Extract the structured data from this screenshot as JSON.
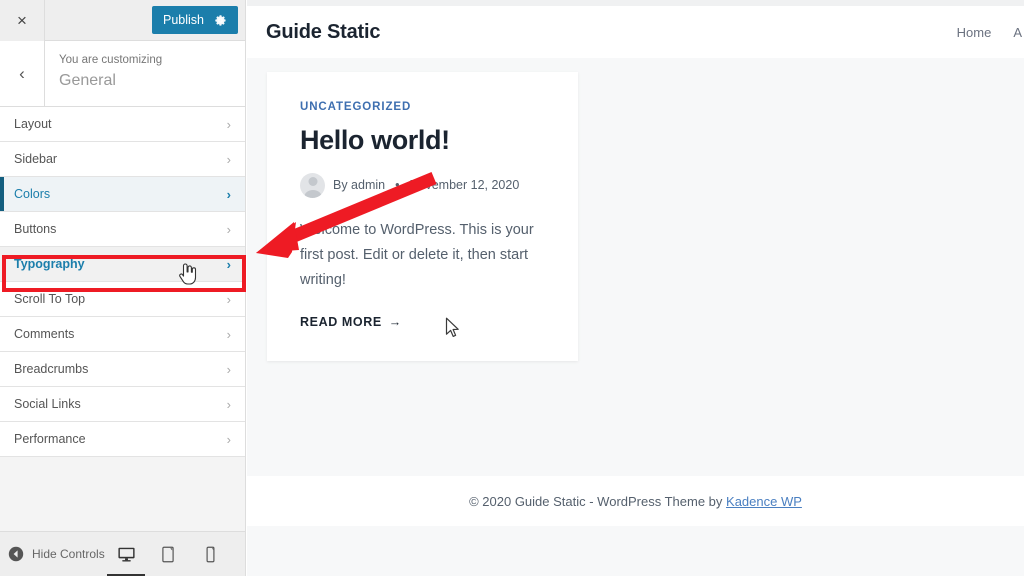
{
  "customizer": {
    "close_label": "×",
    "publish_label": "Publish",
    "gear_icon": "gear-icon",
    "back_label": "‹",
    "panel_kicker": "You are customizing",
    "panel_title": "General",
    "sections": [
      {
        "label": "Layout",
        "chevron": "›",
        "state": "normal"
      },
      {
        "label": "Sidebar",
        "chevron": "›",
        "state": "normal"
      },
      {
        "label": "Colors",
        "chevron": "›",
        "state": "hovered"
      },
      {
        "label": "Buttons",
        "chevron": "›",
        "state": "normal"
      },
      {
        "label": "Typography",
        "chevron": "›",
        "state": "highlighted"
      },
      {
        "label": "Scroll To Top",
        "chevron": "›",
        "state": "normal"
      },
      {
        "label": "Comments",
        "chevron": "›",
        "state": "normal"
      },
      {
        "label": "Breadcrumbs",
        "chevron": "›",
        "state": "normal"
      },
      {
        "label": "Social Links",
        "chevron": "›",
        "state": "normal"
      },
      {
        "label": "Performance",
        "chevron": "›",
        "state": "normal"
      }
    ],
    "footer": {
      "hide_controls_label": "Hide Controls",
      "hide_controls_icon": "collapse-left-arrow-icon",
      "devices": [
        {
          "name": "desktop-preview-button",
          "icon": "desktop-icon",
          "active": true
        },
        {
          "name": "tablet-preview-button",
          "icon": "tablet-icon",
          "active": false
        },
        {
          "name": "mobile-preview-button",
          "icon": "mobile-icon",
          "active": false
        }
      ]
    }
  },
  "preview": {
    "site_title": "Guide Static",
    "nav": [
      {
        "label": "Home"
      },
      {
        "label": "A"
      }
    ],
    "post": {
      "category": "UNCATEGORIZED",
      "title": "Hello world!",
      "author": "By admin",
      "separator": "•",
      "date": "November 12, 2020",
      "excerpt": "Welcome to WordPress. This is your first post. Edit or delete it, then start writing!",
      "read_more_label": "READ MORE",
      "read_more_arrow": "→"
    },
    "footer": {
      "text": "© 2020 Guide Static - WordPress Theme by ",
      "link_label": "Kadence WP"
    }
  },
  "annotations": {
    "arrow_color": "#ee1b24",
    "box_color": "#ee1b24",
    "pointer_cursor": "hand-pointer-cursor",
    "arrow_cursor": "arrow-cursor"
  },
  "colors": {
    "publish_blue": "#1b7eab",
    "accent_bar": "#135e7f",
    "link_blue": "#4a7fc1",
    "category_blue": "#3e6fb0",
    "annotation_red": "#ee1b24"
  }
}
